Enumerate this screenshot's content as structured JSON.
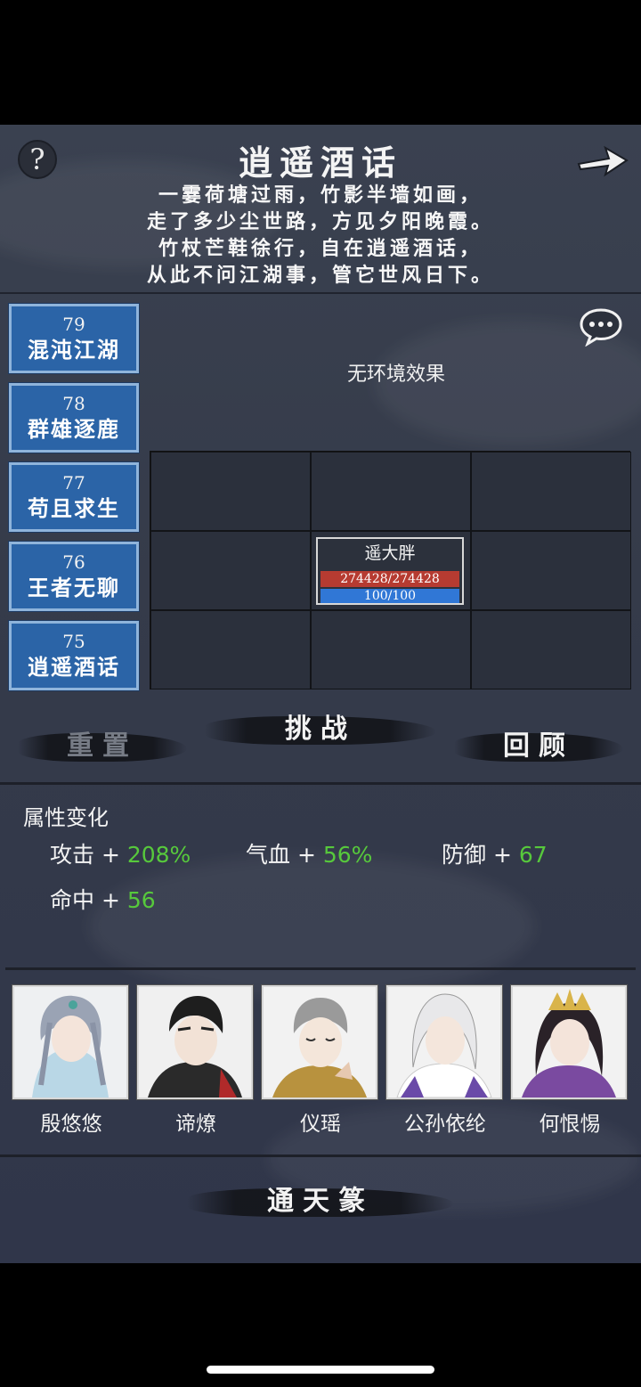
{
  "header": {
    "title": "逍遥酒话",
    "poem": [
      "一霎荷塘过雨，竹影半墙如画，",
      "走了多少尘世路，方见夕阳晚霞。",
      "竹杖芒鞋徐行，自在逍遥酒话，",
      "从此不问江湖事，管它世风日下。"
    ],
    "help_label": "?"
  },
  "levels": [
    {
      "num": "79",
      "name": "混沌江湖"
    },
    {
      "num": "78",
      "name": "群雄逐鹿"
    },
    {
      "num": "77",
      "name": "苟且求生"
    },
    {
      "num": "76",
      "name": "王者无聊"
    },
    {
      "num": "75",
      "name": "逍遥酒话"
    }
  ],
  "environment": "无环境效果",
  "enemy": {
    "name": "遥大胖",
    "hp": "274428/274428",
    "mp": "100/100",
    "hp_fraction": 1.0,
    "mp_fraction": 1.0
  },
  "buttons": {
    "reset": "重置",
    "challenge": "挑战",
    "review": "回顾",
    "tongtian": "通天篆"
  },
  "attributes": {
    "title": "属性变化",
    "items": [
      {
        "label": "攻击 + ",
        "value": "208%"
      },
      {
        "label": "气血 + ",
        "value": "56%"
      },
      {
        "label": "防御 + ",
        "value": "67"
      },
      {
        "label": "命中 + ",
        "value": "56"
      }
    ]
  },
  "heroes": [
    {
      "name": "殷悠悠"
    },
    {
      "name": "谛燎"
    },
    {
      "name": "仪瑶"
    },
    {
      "name": "公孙依纶"
    },
    {
      "name": "何恨惕"
    }
  ],
  "colors": {
    "level_blue": "#2b64a7",
    "hp_red": "#b63b31",
    "mp_blue": "#3077d6",
    "buff_green": "#57c93c"
  }
}
